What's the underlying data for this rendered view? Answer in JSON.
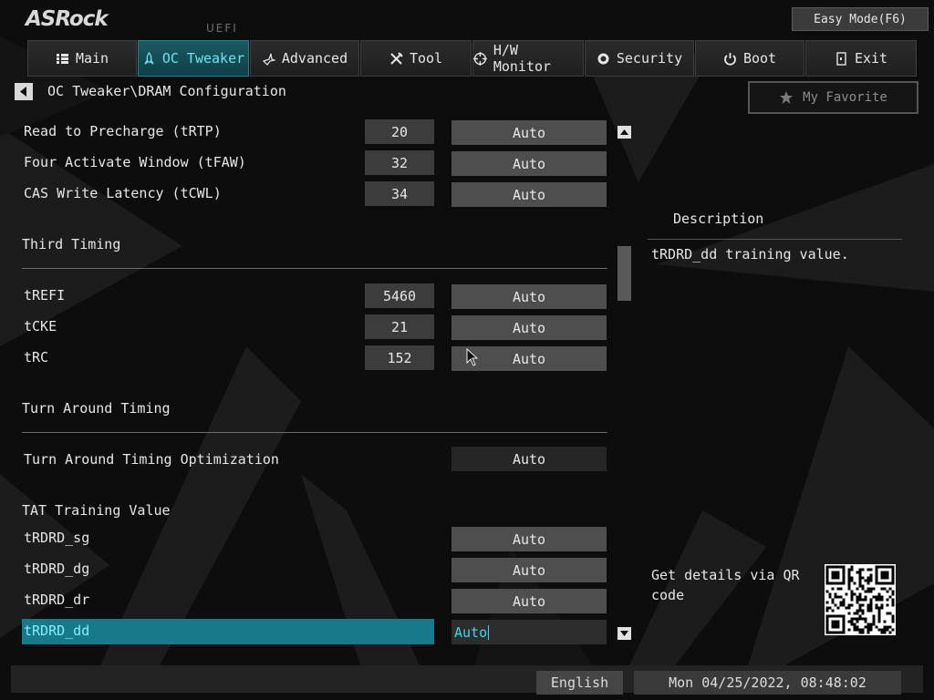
{
  "header": {
    "logo_text": "ASRock",
    "uefi_label": "UEFI",
    "easy_mode_label": "Easy Mode(F6)"
  },
  "nav": {
    "tabs": [
      {
        "label": "Main",
        "icon": "list-icon",
        "active": false
      },
      {
        "label": "OC Tweaker",
        "icon": "rocket-icon",
        "active": true
      },
      {
        "label": "Advanced",
        "icon": "star-icon",
        "active": false
      },
      {
        "label": "Tool",
        "icon": "tools-icon",
        "active": false
      },
      {
        "label": "H/W Monitor",
        "icon": "target-icon",
        "active": false
      },
      {
        "label": "Security",
        "icon": "shield-icon",
        "active": false
      },
      {
        "label": "Boot",
        "icon": "power-icon",
        "active": false
      },
      {
        "label": "Exit",
        "icon": "exit-icon",
        "active": false
      }
    ]
  },
  "breadcrumb": "OC Tweaker\\DRAM Configuration",
  "favorite_label": "My Favorite",
  "settings": {
    "rows": [
      {
        "label": "Read to Precharge (tRTP)",
        "value": "20",
        "option": "Auto"
      },
      {
        "label": "Four Activate Window (tFAW)",
        "value": "32",
        "option": "Auto"
      },
      {
        "label": "CAS Write Latency (tCWL)",
        "value": "34",
        "option": "Auto"
      }
    ],
    "third_timing_title": "Third Timing",
    "third_rows": [
      {
        "label": "tREFI",
        "value": "5460",
        "option": "Auto"
      },
      {
        "label": "tCKE",
        "value": "21",
        "option": "Auto"
      },
      {
        "label": "tRC",
        "value": "152",
        "option": "Auto"
      }
    ],
    "turn_around_title": "Turn Around Timing",
    "tat_opt": {
      "label": "Turn Around Timing Optimization",
      "option": "Auto"
    },
    "tat_training_title": "TAT Training Value",
    "tat_rows": [
      {
        "label": "tRDRD_sg",
        "option": "Auto"
      },
      {
        "label": "tRDRD_dg",
        "option": "Auto"
      },
      {
        "label": "tRDRD_dr",
        "option": "Auto"
      },
      {
        "label": "tRDRD_dd",
        "option": "Auto"
      }
    ]
  },
  "description": {
    "title": "Description",
    "text": "tRDRD_dd training value.",
    "qr_text": "Get details via QR code"
  },
  "footer": {
    "language": "English",
    "datetime": "Mon 04/25/2022, 08:48:02"
  },
  "colors": {
    "accent": "#17798a",
    "active_tab": "#1a5b63",
    "editing_text": "#3cd7ec"
  }
}
